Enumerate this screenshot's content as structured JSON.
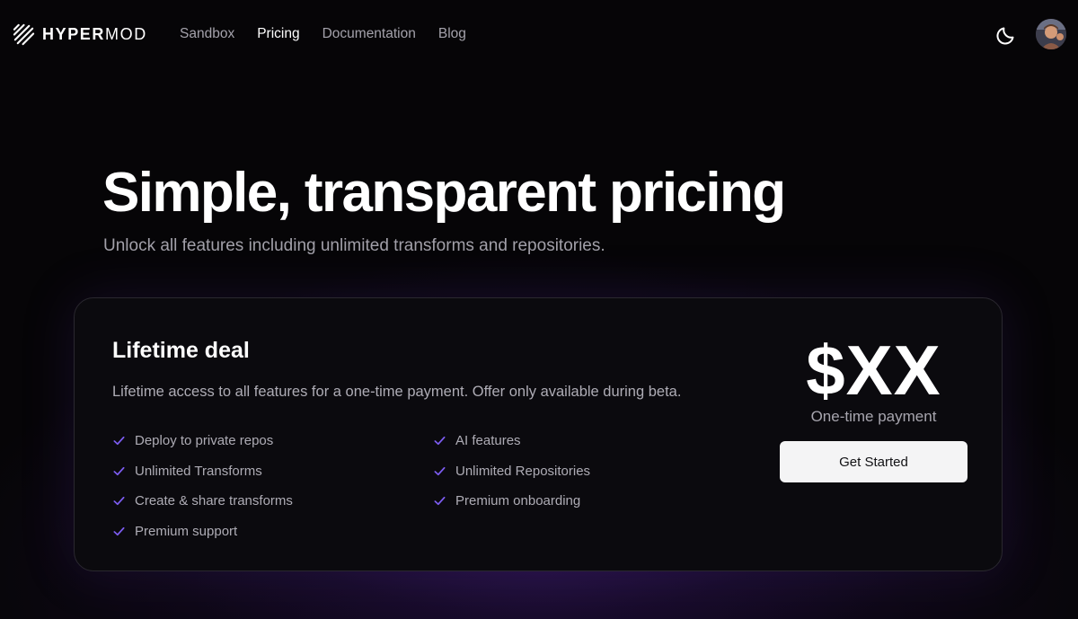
{
  "brand": {
    "name_bold": "HYPER",
    "name_light": "MOD"
  },
  "nav": {
    "items": [
      {
        "label": "Sandbox",
        "active": false
      },
      {
        "label": "Pricing",
        "active": true
      },
      {
        "label": "Documentation",
        "active": false
      },
      {
        "label": "Blog",
        "active": false
      }
    ]
  },
  "header_actions": {
    "theme_toggle_icon": "moon-icon",
    "avatar_icon": "user-avatar"
  },
  "hero": {
    "title": "Simple, transparent pricing",
    "subtitle": "Unlock all features including unlimited transforms and repositories."
  },
  "plan": {
    "title": "Lifetime deal",
    "description": "Lifetime access to all features for a one-time payment. Offer only available during beta.",
    "features": [
      "Deploy to private repos",
      "Unlimited Transforms",
      "Create & share transforms",
      "Premium support",
      "AI features",
      "Unlimited Repositories",
      "Premium onboarding"
    ],
    "price": "$XX",
    "price_note": "One-time payment",
    "cta_label": "Get Started"
  },
  "colors": {
    "background": "#060507",
    "card": "#0b0a0e",
    "accent_check": "#7c5cf0",
    "muted_text": "#aeacb5",
    "button_bg": "#f4f4f5"
  }
}
